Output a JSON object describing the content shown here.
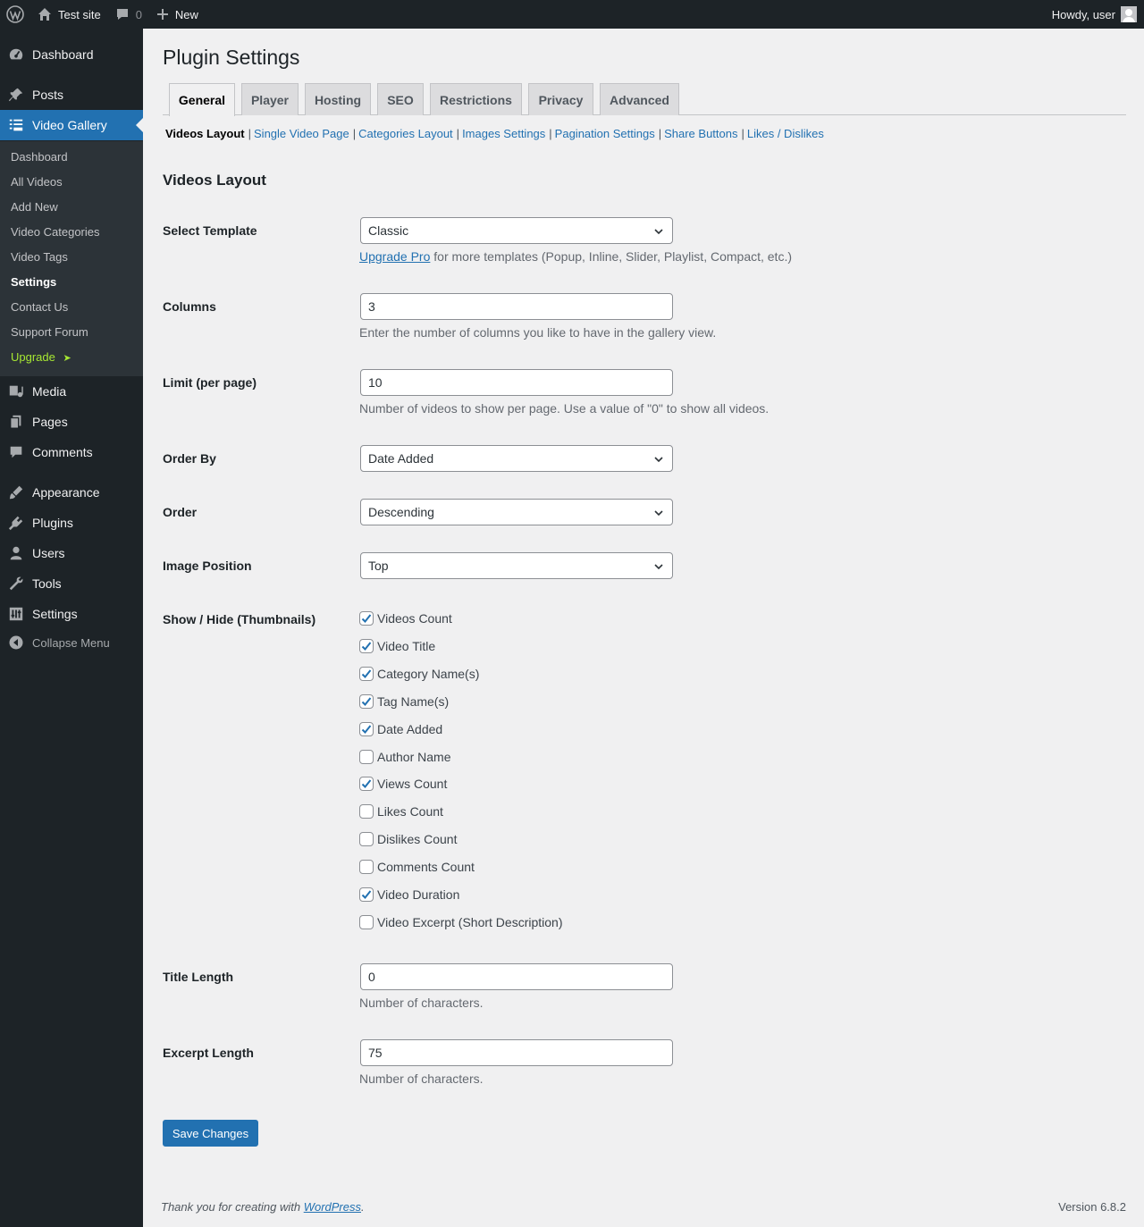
{
  "admin_bar": {
    "site_name": "Test site",
    "comments_count": "0",
    "new_label": "New",
    "howdy": "Howdy, user"
  },
  "sidebar": {
    "items": [
      {
        "label": "Dashboard",
        "icon": "dashboard-icon"
      },
      {
        "label": "Posts",
        "icon": "pin-icon"
      },
      {
        "label": "Video Gallery",
        "icon": "video-list-icon"
      },
      {
        "label": "Media",
        "icon": "media-icon"
      },
      {
        "label": "Pages",
        "icon": "pages-icon"
      },
      {
        "label": "Comments",
        "icon": "comment-icon"
      },
      {
        "label": "Appearance",
        "icon": "brush-icon"
      },
      {
        "label": "Plugins",
        "icon": "plugin-icon"
      },
      {
        "label": "Users",
        "icon": "users-icon"
      },
      {
        "label": "Tools",
        "icon": "wrench-icon"
      },
      {
        "label": "Settings",
        "icon": "settings-icon"
      }
    ],
    "submenu": [
      "Dashboard",
      "All Videos",
      "Add New",
      "Video Categories",
      "Video Tags",
      "Settings",
      "Contact Us",
      "Support Forum",
      "Upgrade"
    ],
    "upgrade_arrow": "➤",
    "collapse_label": "Collapse Menu"
  },
  "page": {
    "title": "Plugin Settings",
    "tabs": [
      "General",
      "Player",
      "Hosting",
      "SEO",
      "Restrictions",
      "Privacy",
      "Advanced"
    ],
    "active_tab": "General",
    "subsections": [
      "Videos Layout",
      "Single Video Page",
      "Categories Layout",
      "Images Settings",
      "Pagination Settings",
      "Share Buttons",
      "Likes / Dislikes"
    ],
    "section_title": "Videos Layout"
  },
  "form": {
    "template": {
      "label": "Select Template",
      "value": "Classic",
      "upgrade_link": "Upgrade Pro",
      "description": " for more templates (Popup, Inline, Slider, Playlist, Compact, etc.)"
    },
    "columns": {
      "label": "Columns",
      "value": "3",
      "description": "Enter the number of columns you like to have in the gallery view."
    },
    "limit": {
      "label": "Limit (per page)",
      "value": "10",
      "description": "Number of videos to show per page. Use a value of \"0\" to show all videos."
    },
    "order_by": {
      "label": "Order By",
      "value": "Date Added"
    },
    "order": {
      "label": "Order",
      "value": "Descending"
    },
    "image_position": {
      "label": "Image Position",
      "value": "Top"
    },
    "show_hide": {
      "label": "Show / Hide (Thumbnails)",
      "options": [
        {
          "label": "Videos Count",
          "checked": true
        },
        {
          "label": "Video Title",
          "checked": true
        },
        {
          "label": "Category Name(s)",
          "checked": true
        },
        {
          "label": "Tag Name(s)",
          "checked": true
        },
        {
          "label": "Date Added",
          "checked": true
        },
        {
          "label": "Author Name",
          "checked": false
        },
        {
          "label": "Views Count",
          "checked": true
        },
        {
          "label": "Likes Count",
          "checked": false
        },
        {
          "label": "Dislikes Count",
          "checked": false
        },
        {
          "label": "Comments Count",
          "checked": false
        },
        {
          "label": "Video Duration",
          "checked": true
        },
        {
          "label": "Video Excerpt (Short Description)",
          "checked": false
        }
      ]
    },
    "title_length": {
      "label": "Title Length",
      "value": "0",
      "description": "Number of characters."
    },
    "excerpt_length": {
      "label": "Excerpt Length",
      "value": "75",
      "description": "Number of characters."
    },
    "save_label": "Save Changes"
  },
  "footer": {
    "thanks_prefix": "Thank you for creating with ",
    "thanks_link": "WordPress",
    "thanks_suffix": ".",
    "version": "Version 6.8.2"
  },
  "colors": {
    "accent": "#2271b1",
    "admin_dark": "#1d2327",
    "upgrade": "#a7e832"
  }
}
